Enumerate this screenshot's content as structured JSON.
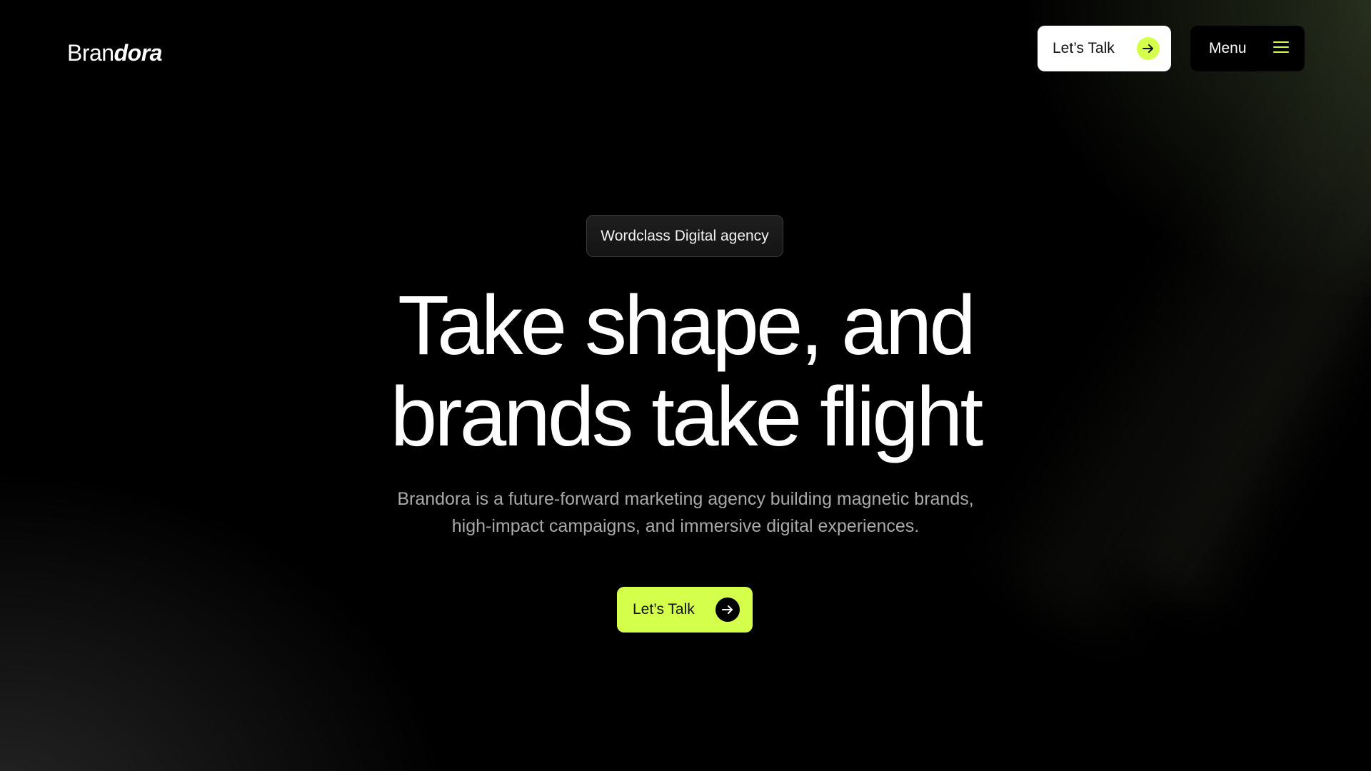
{
  "brand": {
    "logo_regular": "Bran",
    "logo_bold": "dora"
  },
  "header": {
    "talk_label": "Let’s Talk",
    "talk_icon": "arrow-right-icon",
    "menu_label": "Menu",
    "menu_icon": "hamburger-icon"
  },
  "hero": {
    "badge": "Wordclass Digital agency",
    "headline_line1": "Take shape, and",
    "headline_line2": "brands take flight",
    "subtext_line1": "Brandora is a future-forward marketing agency building magnetic brands,",
    "subtext_line2": "high-impact campaigns, and immersive digital experiences.",
    "cta_label": "Let’s Talk",
    "cta_icon": "arrow-right-icon"
  },
  "colors": {
    "accent": "#d4ff4a",
    "background": "#000000",
    "text_primary": "#ffffff",
    "text_muted": "#a9a9a9"
  }
}
